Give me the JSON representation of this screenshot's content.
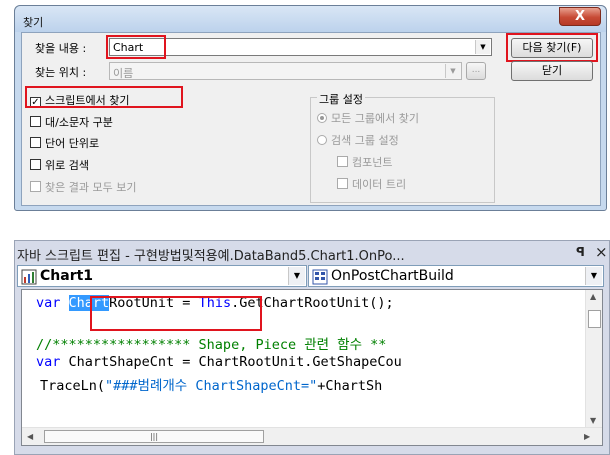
{
  "find_dialog": {
    "title": "찾기",
    "close_label": "X",
    "find_what_label": "찾을 내용 :",
    "find_what_value": "Chart",
    "look_in_label": "찾는 위치 :",
    "look_in_value": "이름",
    "browse_label": "...",
    "find_next_label": "다음 찾기(F)",
    "close_button_label": "닫기",
    "options": [
      {
        "label": "스크립트에서 찾기",
        "checked": true,
        "enabled": true
      },
      {
        "label": "대/소문자 구분",
        "checked": false,
        "enabled": true
      },
      {
        "label": "단어 단위로",
        "checked": false,
        "enabled": true
      },
      {
        "label": "위로 검색",
        "checked": false,
        "enabled": true
      },
      {
        "label": "찾은 결과 모두 보기",
        "checked": false,
        "enabled": false
      }
    ],
    "group_settings": {
      "legend": "그룹 설정",
      "all_groups_label": "모든 그룹에서 찾기",
      "search_group_label": "검색 그룹 설정",
      "component_label": "컴포넌트",
      "data_tree_label": "데이터 트리"
    }
  },
  "script_editor": {
    "title": "자바 스크립트 편집 - 구현방법및적용예.DataBand5.Chart1.OnPo...",
    "pin_glyph": "ᴘ",
    "close_glyph": "×",
    "object_value": "Chart1",
    "event_value": "OnPostChartBuild",
    "code": {
      "l1_var": "var ",
      "l1_hl": "Chart",
      "l1_rest_a": "RootUnit = ",
      "l1_this": "This",
      "l1_rest_b": ".GetChartRootUnit();",
      "l2": "//***************** Shape, Piece 관련 함수 **",
      "l3_var": "var ",
      "l3_rest": "ChartShapeCnt = ChartRootUnit.GetShapeCou",
      "l4_a": "TraceLn(",
      "l4_str": "\"###범례개수 ChartShapeCnt=\"",
      "l4_b": "+ChartSh"
    }
  },
  "colors": {
    "highlight_box": "#e0141e",
    "selection": "#3399ff",
    "keyword": "#0000ff",
    "comment": "#008000"
  }
}
